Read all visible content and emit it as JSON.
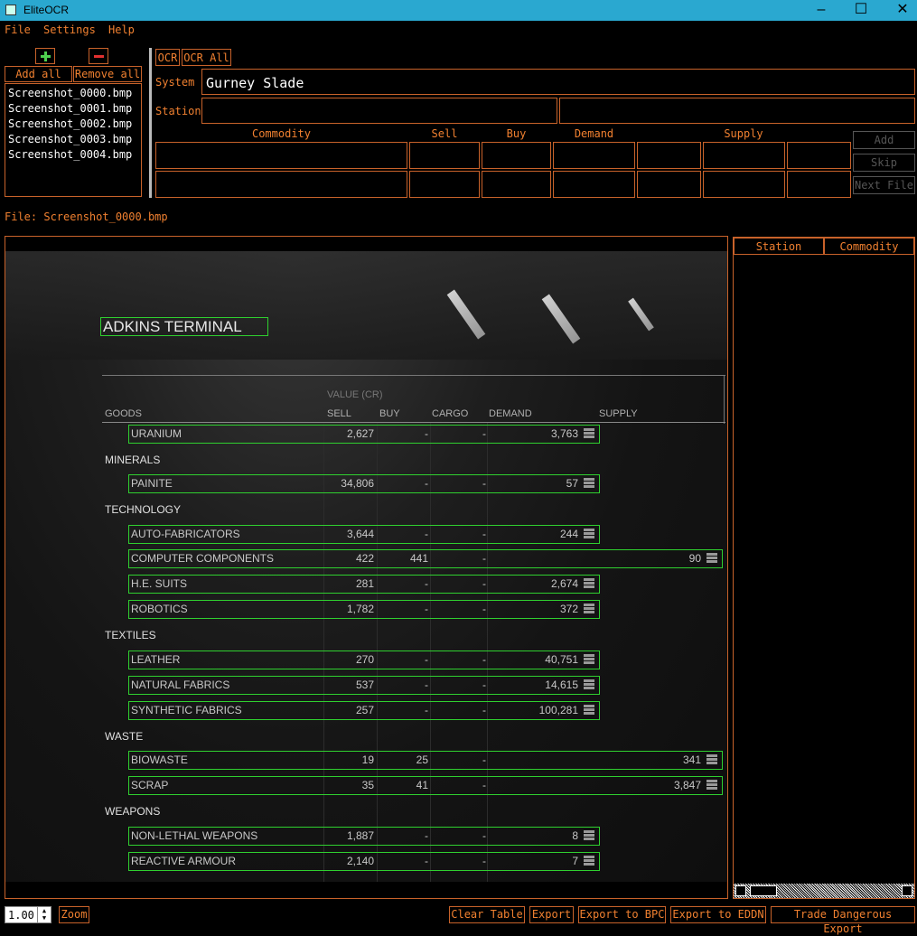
{
  "window": {
    "title": "EliteOCR"
  },
  "menu": {
    "file": "File",
    "settings": "Settings",
    "help": "Help"
  },
  "files": {
    "add_all": "Add all",
    "remove_all": "Remove all",
    "list": [
      "Screenshot_0000.bmp",
      "Screenshot_0001.bmp",
      "Screenshot_0002.bmp",
      "Screenshot_0003.bmp",
      "Screenshot_0004.bmp"
    ],
    "current_label": "File: Screenshot_0000.bmp"
  },
  "ocr": {
    "ocr": "OCR",
    "ocr_all": "OCR All"
  },
  "form": {
    "system_label": "System",
    "system_value": "Gurney Slade",
    "station_label": "Station",
    "station_value": "",
    "headers": {
      "commodity": "Commodity",
      "sell": "Sell",
      "buy": "Buy",
      "demand": "Demand",
      "supply": "Supply"
    },
    "add": "Add",
    "skip": "Skip",
    "next_file": "Next File"
  },
  "results": {
    "station": "Station",
    "commodity": "Commodity"
  },
  "bottom": {
    "zoom_value": "1.00",
    "zoom": "Zoom",
    "clear_table": "Clear Table",
    "export": "Export",
    "export_bpc": "Export to BPC",
    "export_eddn": "Export to EDDN",
    "trade_dangerous": "Trade Dangerous Export"
  },
  "market": {
    "station_name": "ADKINS TERMINAL",
    "value_label": "VALUE (CR)",
    "columns": {
      "goods": "GOODS",
      "sell": "SELL",
      "buy": "BUY",
      "cargo": "CARGO",
      "demand": "DEMAND",
      "supply": "SUPPLY"
    },
    "categories": [
      "MINERALS",
      "TECHNOLOGY",
      "TEXTILES",
      "WASTE",
      "WEAPONS"
    ],
    "rows": [
      {
        "name": "URANIUM",
        "sell": "2,627",
        "buy": "-",
        "cargo": "-",
        "demand": "3,763",
        "supply": ""
      },
      {
        "name": "PAINITE",
        "sell": "34,806",
        "buy": "-",
        "cargo": "-",
        "demand": "57",
        "supply": ""
      },
      {
        "name": "AUTO-FABRICATORS",
        "sell": "3,644",
        "buy": "-",
        "cargo": "-",
        "demand": "244",
        "supply": ""
      },
      {
        "name": "COMPUTER COMPONENTS",
        "sell": "422",
        "buy": "441",
        "cargo": "-",
        "demand": "",
        "supply": "90"
      },
      {
        "name": "H.E. SUITS",
        "sell": "281",
        "buy": "-",
        "cargo": "-",
        "demand": "2,674",
        "supply": ""
      },
      {
        "name": "ROBOTICS",
        "sell": "1,782",
        "buy": "-",
        "cargo": "-",
        "demand": "372",
        "supply": ""
      },
      {
        "name": "LEATHER",
        "sell": "270",
        "buy": "-",
        "cargo": "-",
        "demand": "40,751",
        "supply": ""
      },
      {
        "name": "NATURAL FABRICS",
        "sell": "537",
        "buy": "-",
        "cargo": "-",
        "demand": "14,615",
        "supply": ""
      },
      {
        "name": "SYNTHETIC FABRICS",
        "sell": "257",
        "buy": "-",
        "cargo": "-",
        "demand": "100,281",
        "supply": ""
      },
      {
        "name": "BIOWASTE",
        "sell": "19",
        "buy": "25",
        "cargo": "-",
        "demand": "",
        "supply": "341"
      },
      {
        "name": "SCRAP",
        "sell": "35",
        "buy": "41",
        "cargo": "-",
        "demand": "",
        "supply": "3,847"
      },
      {
        "name": "NON-LETHAL WEAPONS",
        "sell": "1,887",
        "buy": "-",
        "cargo": "-",
        "demand": "8",
        "supply": ""
      },
      {
        "name": "REACTIVE ARMOUR",
        "sell": "2,140",
        "buy": "-",
        "cargo": "-",
        "demand": "7",
        "supply": ""
      }
    ]
  }
}
